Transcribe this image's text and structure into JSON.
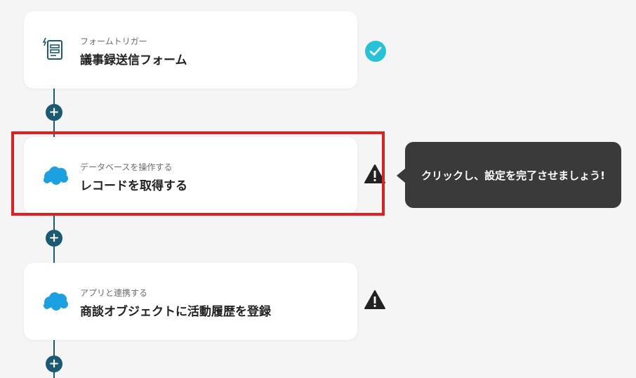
{
  "steps": [
    {
      "subtitle": "フォームトリガー",
      "title": "議事録送信フォーム",
      "icon": "form-icon",
      "status": "check-icon"
    },
    {
      "subtitle": "データベースを操作する",
      "title": "レコードを取得する",
      "icon": "salesforce-cloud-icon",
      "status": "warning-icon"
    },
    {
      "subtitle": "アプリと連携する",
      "title": "商談オブジェクトに活動履歴を登録",
      "icon": "salesforce-cloud-icon",
      "status": "warning-icon"
    }
  ],
  "tooltip": {
    "text": "クリックし、設定を完了させましょう!"
  },
  "add_label": "+",
  "colors": {
    "line": "#1b5a72",
    "check": "#27c2d8",
    "salesforce": "#1ba0e2",
    "highlight": "#e02020",
    "tooltip_bg": "#3a3a3a"
  }
}
